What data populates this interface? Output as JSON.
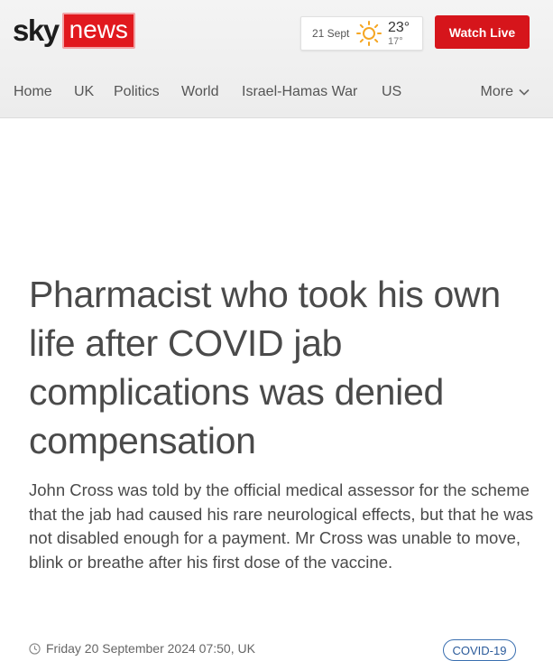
{
  "header": {
    "logo": {
      "sky": "sky",
      "news": "news"
    },
    "weather": {
      "date": "21 Sept",
      "high": "23°",
      "low": "17°",
      "icon": "sun-icon"
    },
    "watch_live_label": "Watch Live"
  },
  "nav": {
    "items": [
      {
        "label": "Home"
      },
      {
        "label": "UK"
      },
      {
        "label": "Politics"
      },
      {
        "label": "World"
      },
      {
        "label": "Israel-Hamas War"
      },
      {
        "label": "US"
      }
    ],
    "more_label": "More"
  },
  "article": {
    "headline": "Pharmacist who took his own life after COVID jab complications was denied compensation",
    "standfirst": "John Cross was told by the official medical assessor for the scheme that the jab had caused his rare neurological effects, but that he was not disabled enough for a payment. Mr Cross was unable to move, blink or breathe after his first dose of the vaccine.",
    "timestamp": "Friday 20 September 2024 07:50, UK",
    "tag": "COVID-19"
  },
  "colors": {
    "brand_red": "#e1191e",
    "watch_live_red": "#d6151b",
    "tag_blue": "#2a5a9a",
    "sun_orange": "#f5a623"
  }
}
